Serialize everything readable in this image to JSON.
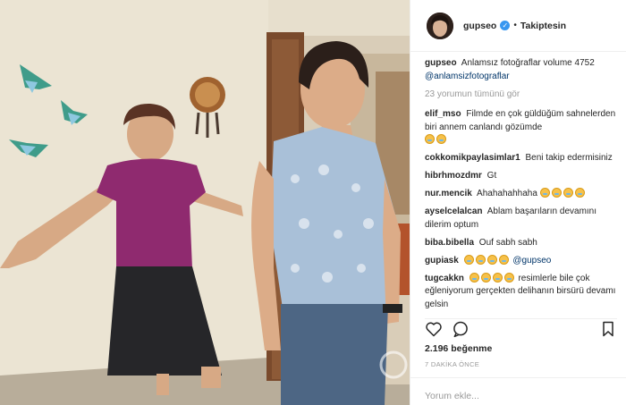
{
  "header": {
    "username": "gupseo",
    "separator": "•",
    "follow_label": "Takiptesin"
  },
  "caption": {
    "username": "gupseo",
    "text": "Anlamsız fotoğraflar volume 4752",
    "hashtag": "@anlamsizfotograflar"
  },
  "view_all_label": "23 yorumun tümünü gör",
  "comments": [
    {
      "user": "elif_mso",
      "text": "Filmde en çok güldüğüm sahnelerden biri annem canlandı gözümde",
      "emoji_count": 2
    },
    {
      "user": "cokkomikpaylasimlar1",
      "text": "Beni takip edermisiniz",
      "emoji_count": 0
    },
    {
      "user": "hibrhmozdmr",
      "text": "Gt",
      "emoji_count": 0
    },
    {
      "user": "nur.mencik",
      "text": "Ahahahahhaha",
      "emoji_count": 4
    },
    {
      "user": "ayselcelalcan",
      "text": "Ablam başarıların devamını dilerim optum",
      "emoji_count": 0
    },
    {
      "user": "biba.bibella",
      "text": "Ouf sabh sabh",
      "emoji_count": 0
    },
    {
      "user": "gupiask",
      "mention": "@gupseo",
      "emoji_count": 4
    },
    {
      "user": "tugcakkn",
      "text": "resimlerle bile çok eğleniyorum gerçekten delihanın birsürü devamı gelsin",
      "emoji_count": 4
    }
  ],
  "actions": {
    "like_icon": "heart-icon",
    "comment_icon": "comment-icon",
    "save_icon": "bookmark-icon"
  },
  "likes_text": "2.196 beğenme",
  "timestamp": "7 DAKİKA ÖNCE",
  "add_comment": {
    "placeholder": "Yorum ekle..."
  },
  "colors": {
    "link": "#003569",
    "muted": "#999999",
    "verified": "#3897f0",
    "text": "#262626"
  }
}
